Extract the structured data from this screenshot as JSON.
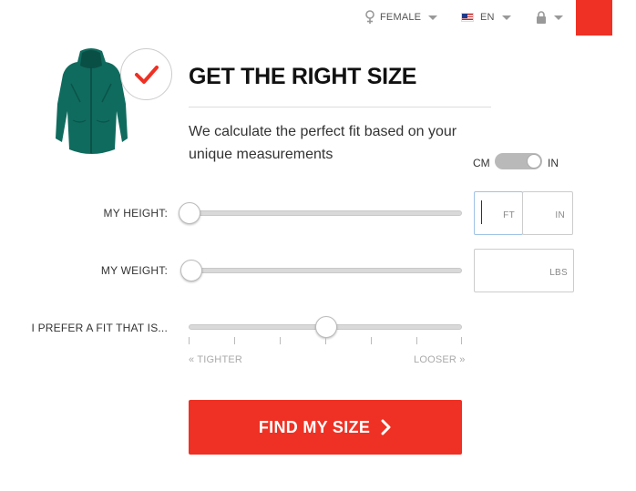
{
  "topbar": {
    "gender": "FEMALE",
    "language": "EN",
    "accent_color": "#ee3124"
  },
  "header": {
    "title": "GET THE RIGHT SIZE",
    "subtitle": "We calculate the perfect fit based on your unique measurements"
  },
  "units": {
    "left": "CM",
    "right": "IN",
    "selected": "IN"
  },
  "height": {
    "label": "MY HEIGHT:",
    "unit_ft": "FT",
    "unit_in": "IN",
    "value_ft": "",
    "value_in": "",
    "slider_fraction": 0
  },
  "weight": {
    "label": "MY WEIGHT:",
    "unit": "LBS",
    "value": "",
    "slider_fraction": 0
  },
  "fit": {
    "label": "I PREFER A FIT THAT IS...",
    "min_label": "« TIGHTER",
    "max_label": "LOOSER »",
    "steps": 7,
    "slider_fraction": 0.5
  },
  "cta": {
    "label": "FIND MY SIZE"
  },
  "icons": {
    "gender": "female-symbol-icon",
    "flag": "us-flag-icon",
    "lock": "lock-icon",
    "check": "checkmark-icon",
    "chevron": "chevron-right-icon"
  }
}
